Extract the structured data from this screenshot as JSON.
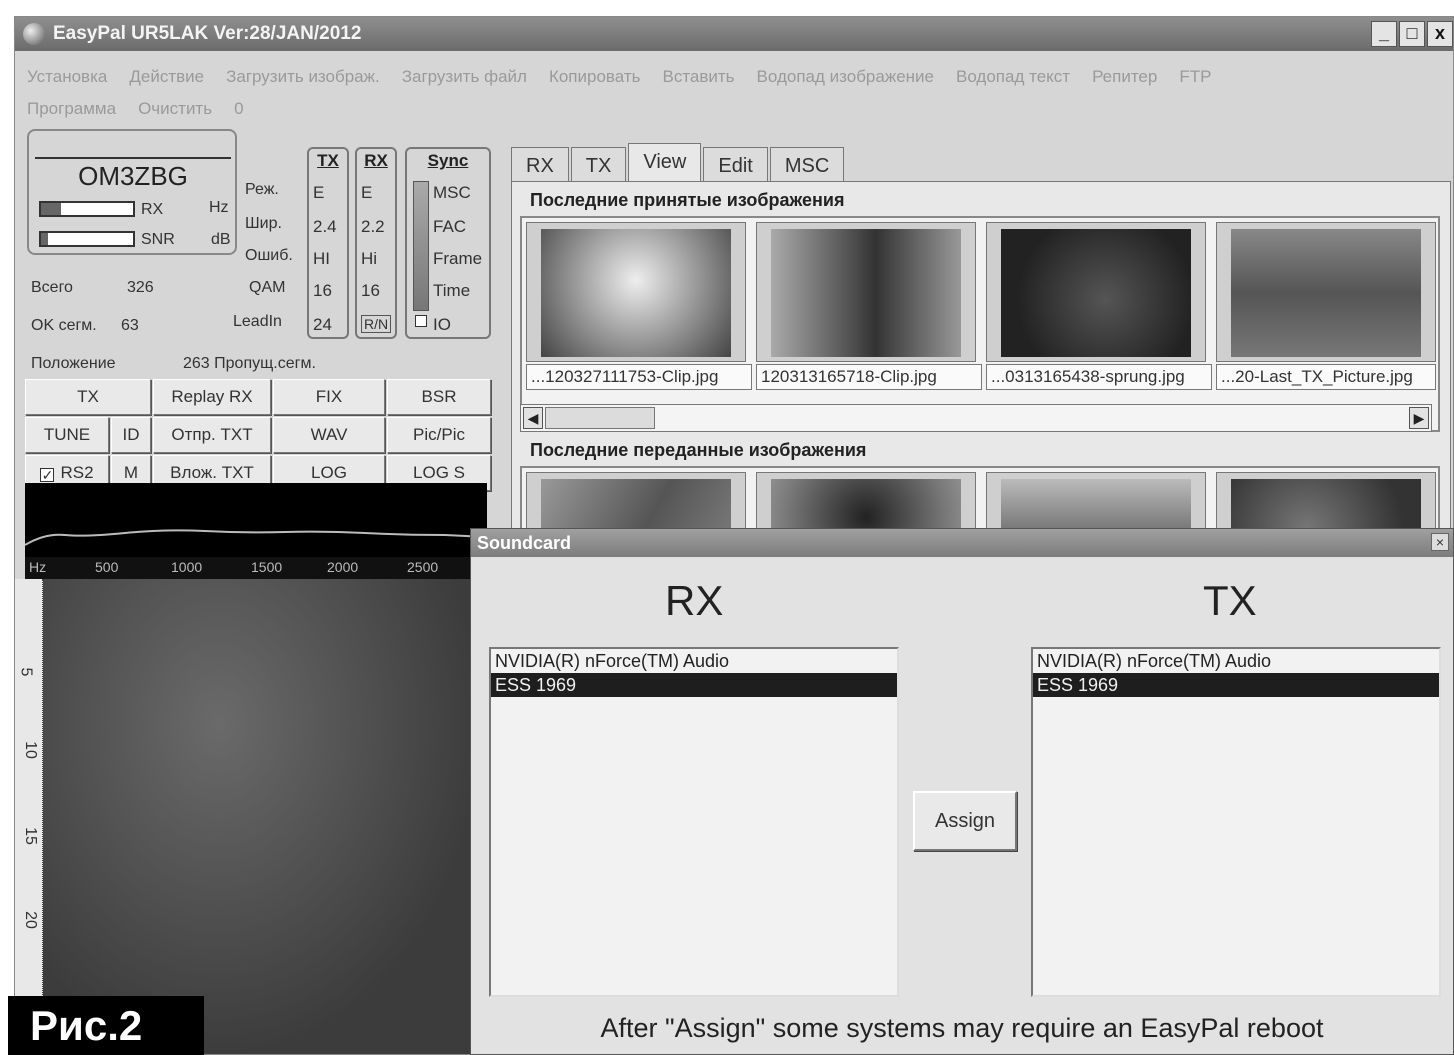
{
  "window": {
    "title": "EasyPal UR5LAK  Ver:28/JAN/2012",
    "controls": [
      "_",
      "□",
      "x"
    ]
  },
  "menu": {
    "row1": [
      "Установка",
      "Действие",
      "Загрузить изображ.",
      "Загрузить файл",
      "Копировать",
      "Вставить",
      "Водопад изображение",
      "Водопад текст",
      "Репитер",
      "FTP"
    ],
    "row2": [
      "Программа",
      "Очистить",
      "0"
    ]
  },
  "status": {
    "callsign": "OM3ZBG",
    "rx_label": "RX",
    "rx_unit": "Hz",
    "snr_label": "SNR",
    "snr_unit": "dB",
    "rx_level": 0.22,
    "snr_level": 0.08,
    "total_label": "Всего",
    "total_value": "326",
    "ok_label": "OK сегм.",
    "ok_value": "63",
    "position_label": "Положение",
    "skipped": "263 Пропущ.сегм."
  },
  "params": {
    "labels": [
      "Реж.",
      "Шир.",
      "Ошиб.",
      "QAM",
      "LeadIn"
    ],
    "tx_head": "TX",
    "tx_values": [
      "E",
      "2.4",
      "HI",
      "16",
      "24"
    ],
    "rx_head": "RX",
    "rx_values": [
      "E",
      "2.2",
      "Hi",
      "16",
      "R/N"
    ],
    "sync_head": "Sync",
    "sync_values": [
      "MSC",
      "FAC",
      "Frame",
      "Time",
      "IO"
    ]
  },
  "buttons": {
    "tx": "TX",
    "replay": "Replay RX",
    "fix": "FIX",
    "bsr": "BSR",
    "tune": "TUNE",
    "id": "ID",
    "send_txt": "Отпр. TXT",
    "wav": "WAV",
    "picpic": "Pic/Pic",
    "rs2": "RS2",
    "m": "M",
    "attach_txt": "Влож. TXT",
    "log": "LOG",
    "logs": "LOG S"
  },
  "spectrum": {
    "ticks": [
      "Hz",
      "500",
      "1000",
      "1500",
      "2000",
      "2500"
    ]
  },
  "waterfall": {
    "axis": [
      "5",
      "10",
      "15",
      "20"
    ]
  },
  "figure_label": "Рис.2",
  "tabs": [
    "RX",
    "TX",
    "View",
    "Edit",
    "MSC"
  ],
  "received": {
    "heading": "Последние принятые изображения",
    "captions": [
      "...120327111753-Clip.jpg",
      "120313165718-Clip.jpg",
      "...0313165438-sprung.jpg",
      "...20-Last_TX_Picture.jpg"
    ]
  },
  "sent": {
    "heading": "Последние переданные изображения"
  },
  "soundcard": {
    "title": "Soundcard",
    "rx_head": "RX",
    "tx_head": "TX",
    "rx_devices": [
      "NVIDIA(R) nForce(TM) Audio",
      "ESS 1969"
    ],
    "tx_devices": [
      "NVIDIA(R) nForce(TM) Audio",
      "ESS 1969"
    ],
    "selected_index": 1,
    "assign_label": "Assign",
    "note": "After \"Assign\" some systems may require an EasyPal reboot"
  }
}
